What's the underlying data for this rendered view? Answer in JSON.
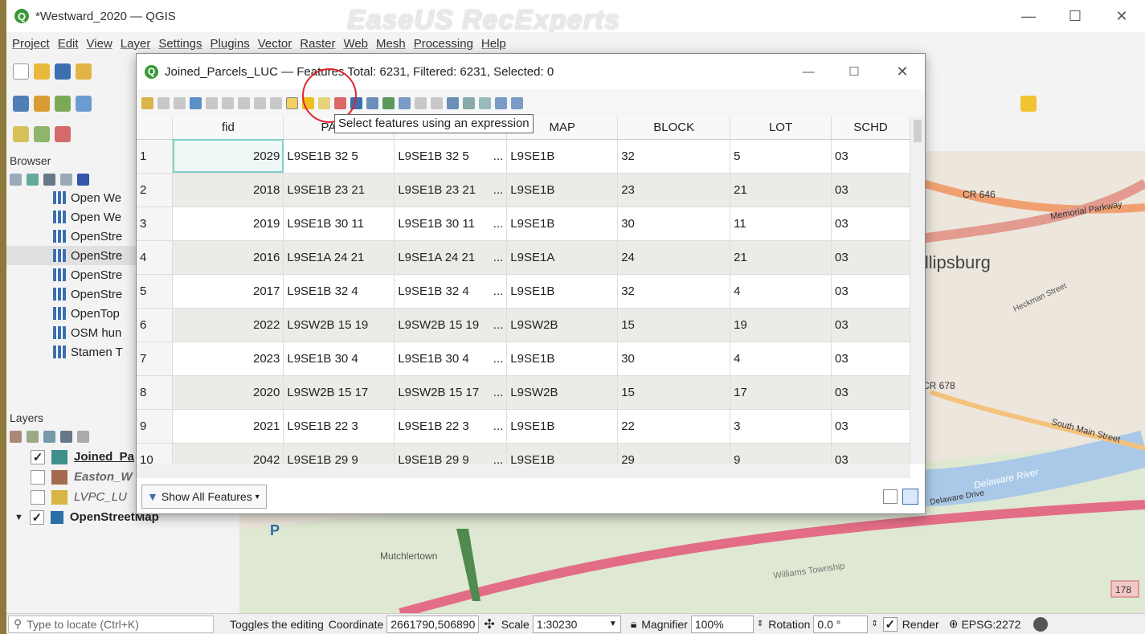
{
  "app": {
    "title": "*Westward_2020 — QGIS",
    "watermark": "EaseUS RecExperts",
    "window_controls": [
      "—",
      "☐",
      "✕"
    ]
  },
  "menubar": [
    "Project",
    "Edit",
    "View",
    "Layer",
    "Settings",
    "Plugins",
    "Vector",
    "Raster",
    "Web",
    "Mesh",
    "Processing",
    "Help"
  ],
  "browser": {
    "header": "Browser",
    "items": [
      "Open We",
      "Open We",
      "OpenStre",
      "OpenStre",
      "OpenStre",
      "OpenStre",
      "OpenTop",
      "OSM hun",
      "Stamen T"
    ]
  },
  "layers": {
    "header": "Layers",
    "items": [
      {
        "name": "Joined_Pa",
        "checked": true,
        "color": "#3f8f8c",
        "style": "bold-underline"
      },
      {
        "name": "Easton_W",
        "checked": false,
        "color": "#a46a50",
        "style": "italic"
      },
      {
        "name": "LVPC_LU",
        "checked": false,
        "color": "#d8b442",
        "style": "italic"
      },
      {
        "name": "OpenStreetMap",
        "checked": true,
        "color": "#2c6ea8",
        "style": "bold"
      }
    ]
  },
  "map_labels": {
    "road1": "CR 646",
    "town": "illipsburg",
    "road2": "CR 678",
    "street1": "Memorial Parkway",
    "street2": "Heckman Street",
    "street3": "South Main Street",
    "river": "Delaware River",
    "drive": "Delaware Drive",
    "area1": "Mutchlertown",
    "area2": "Williams Township",
    "hwy": "178",
    "parking": "P"
  },
  "dialog": {
    "title": "Joined_Parcels_LUC — Features Total: 6231, Filtered: 6231, Selected: 0",
    "tooltip": "Select features using an expression",
    "columns": [
      "fid",
      "PAR…",
      "",
      "MAP",
      "BLOCK",
      "LOT",
      "SCHD"
    ],
    "rows": [
      {
        "n": "1",
        "fid": "2029",
        "par": "L9SE1B 32 5",
        "c3": "L9SE1B 32 5",
        "c3b": "...",
        "map": "L9SE1B",
        "block": "32",
        "lot": "5",
        "schd": "03"
      },
      {
        "n": "2",
        "fid": "2018",
        "par": "L9SE1B 23 21",
        "c3": "L9SE1B 23 21",
        "c3b": "...",
        "map": "L9SE1B",
        "block": "23",
        "lot": "21",
        "schd": "03"
      },
      {
        "n": "3",
        "fid": "2019",
        "par": "L9SE1B 30 11",
        "c3": "L9SE1B 30 11",
        "c3b": "...",
        "map": "L9SE1B",
        "block": "30",
        "lot": "11",
        "schd": "03"
      },
      {
        "n": "4",
        "fid": "2016",
        "par": "L9SE1A 24 21",
        "c3": "L9SE1A 24 21",
        "c3b": "...",
        "map": "L9SE1A",
        "block": "24",
        "lot": "21",
        "schd": "03"
      },
      {
        "n": "5",
        "fid": "2017",
        "par": "L9SE1B 32 4",
        "c3": "L9SE1B 32 4",
        "c3b": "...",
        "map": "L9SE1B",
        "block": "32",
        "lot": "4",
        "schd": "03"
      },
      {
        "n": "6",
        "fid": "2022",
        "par": "L9SW2B 15 19",
        "c3": "L9SW2B 15 19",
        "c3b": "...",
        "map": "L9SW2B",
        "block": "15",
        "lot": "19",
        "schd": "03"
      },
      {
        "n": "7",
        "fid": "2023",
        "par": "L9SE1B 30 4",
        "c3": "L9SE1B 30 4",
        "c3b": "...",
        "map": "L9SE1B",
        "block": "30",
        "lot": "4",
        "schd": "03"
      },
      {
        "n": "8",
        "fid": "2020",
        "par": "L9SW2B 15 17",
        "c3": "L9SW2B 15 17",
        "c3b": "...",
        "map": "L9SW2B",
        "block": "15",
        "lot": "17",
        "schd": "03"
      },
      {
        "n": "9",
        "fid": "2021",
        "par": "L9SE1B 22 3",
        "c3": "L9SE1B 22 3",
        "c3b": "...",
        "map": "L9SE1B",
        "block": "22",
        "lot": "3",
        "schd": "03"
      },
      {
        "n": "10",
        "fid": "2042",
        "par": "L9SE1B 29 9",
        "c3": "L9SE1B 29 9",
        "c3b": "...",
        "map": "L9SE1B",
        "block": "29",
        "lot": "9",
        "schd": "03"
      }
    ],
    "show_all": "Show All Features"
  },
  "statusbar": {
    "locate_placeholder": "Type to locate (Ctrl+K)",
    "message": "Toggles the editing",
    "coordinate_label": "Coordinate",
    "coordinate_value": "2661790,506890",
    "scale_label": "Scale",
    "scale_value": "1:30230",
    "magnifier_label": "Magnifier",
    "magnifier_value": "100%",
    "rotation_label": "Rotation",
    "rotation_value": "0.0 °",
    "render_label": "Render",
    "crs": "EPSG:2272"
  }
}
